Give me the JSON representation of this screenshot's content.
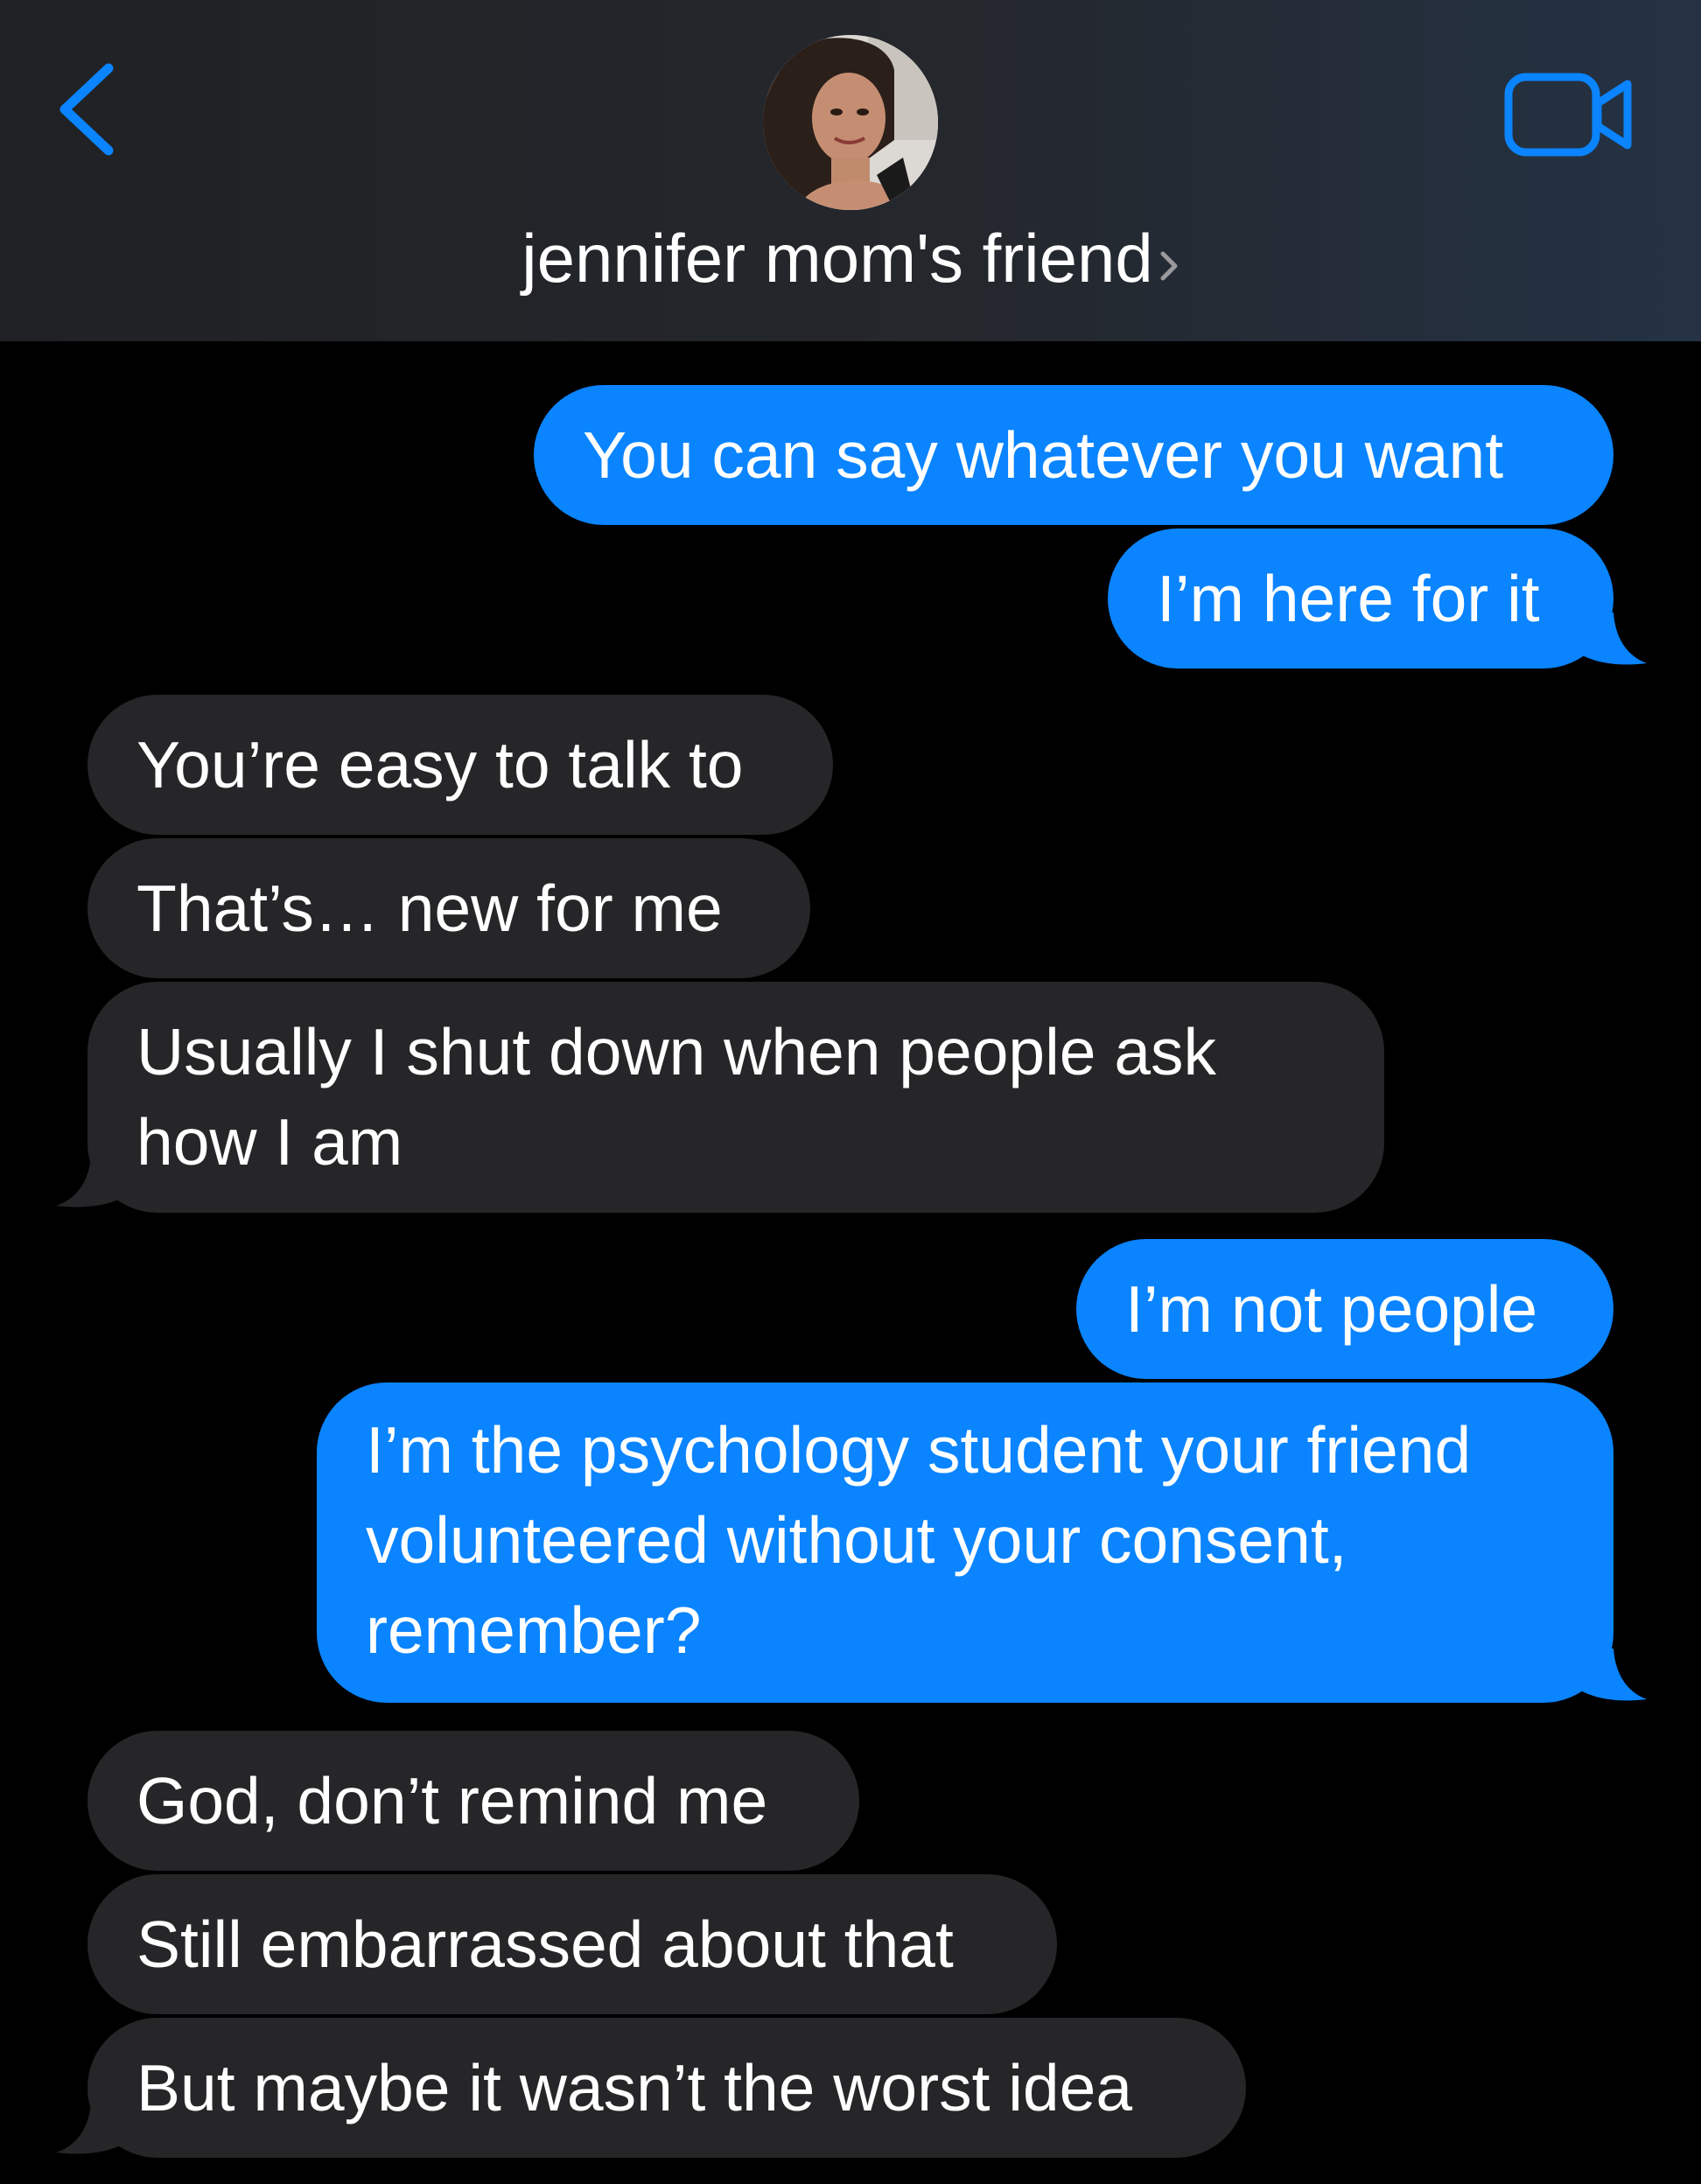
{
  "header": {
    "back_label": "Back",
    "contact_name": "jennifer mom's friend",
    "chevron": "›",
    "icons": {
      "back": "chevron-left-icon",
      "video": "video-camera-icon",
      "details": "chevron-right-icon"
    }
  },
  "colors": {
    "outgoing": "#0a84ff",
    "incoming": "#262628",
    "accent": "#0a84ff",
    "background": "#000000"
  },
  "messages": [
    {
      "from": "me",
      "text": "You can say whatever you want"
    },
    {
      "from": "me",
      "text": "I’m here for it"
    },
    {
      "from": "them",
      "text": "You’re easy to talk to"
    },
    {
      "from": "them",
      "text": "That’s… new for me"
    },
    {
      "from": "them",
      "text": "Usually I shut down when people ask how I am"
    },
    {
      "from": "me",
      "text": "I’m not people"
    },
    {
      "from": "me",
      "text": "I’m the psychology student your friend volunteered without your consent, remember?"
    },
    {
      "from": "them",
      "text": "God, don’t remind me"
    },
    {
      "from": "them",
      "text": "Still embarrassed about that"
    },
    {
      "from": "them",
      "text": "But maybe it wasn’t the worst idea"
    }
  ]
}
